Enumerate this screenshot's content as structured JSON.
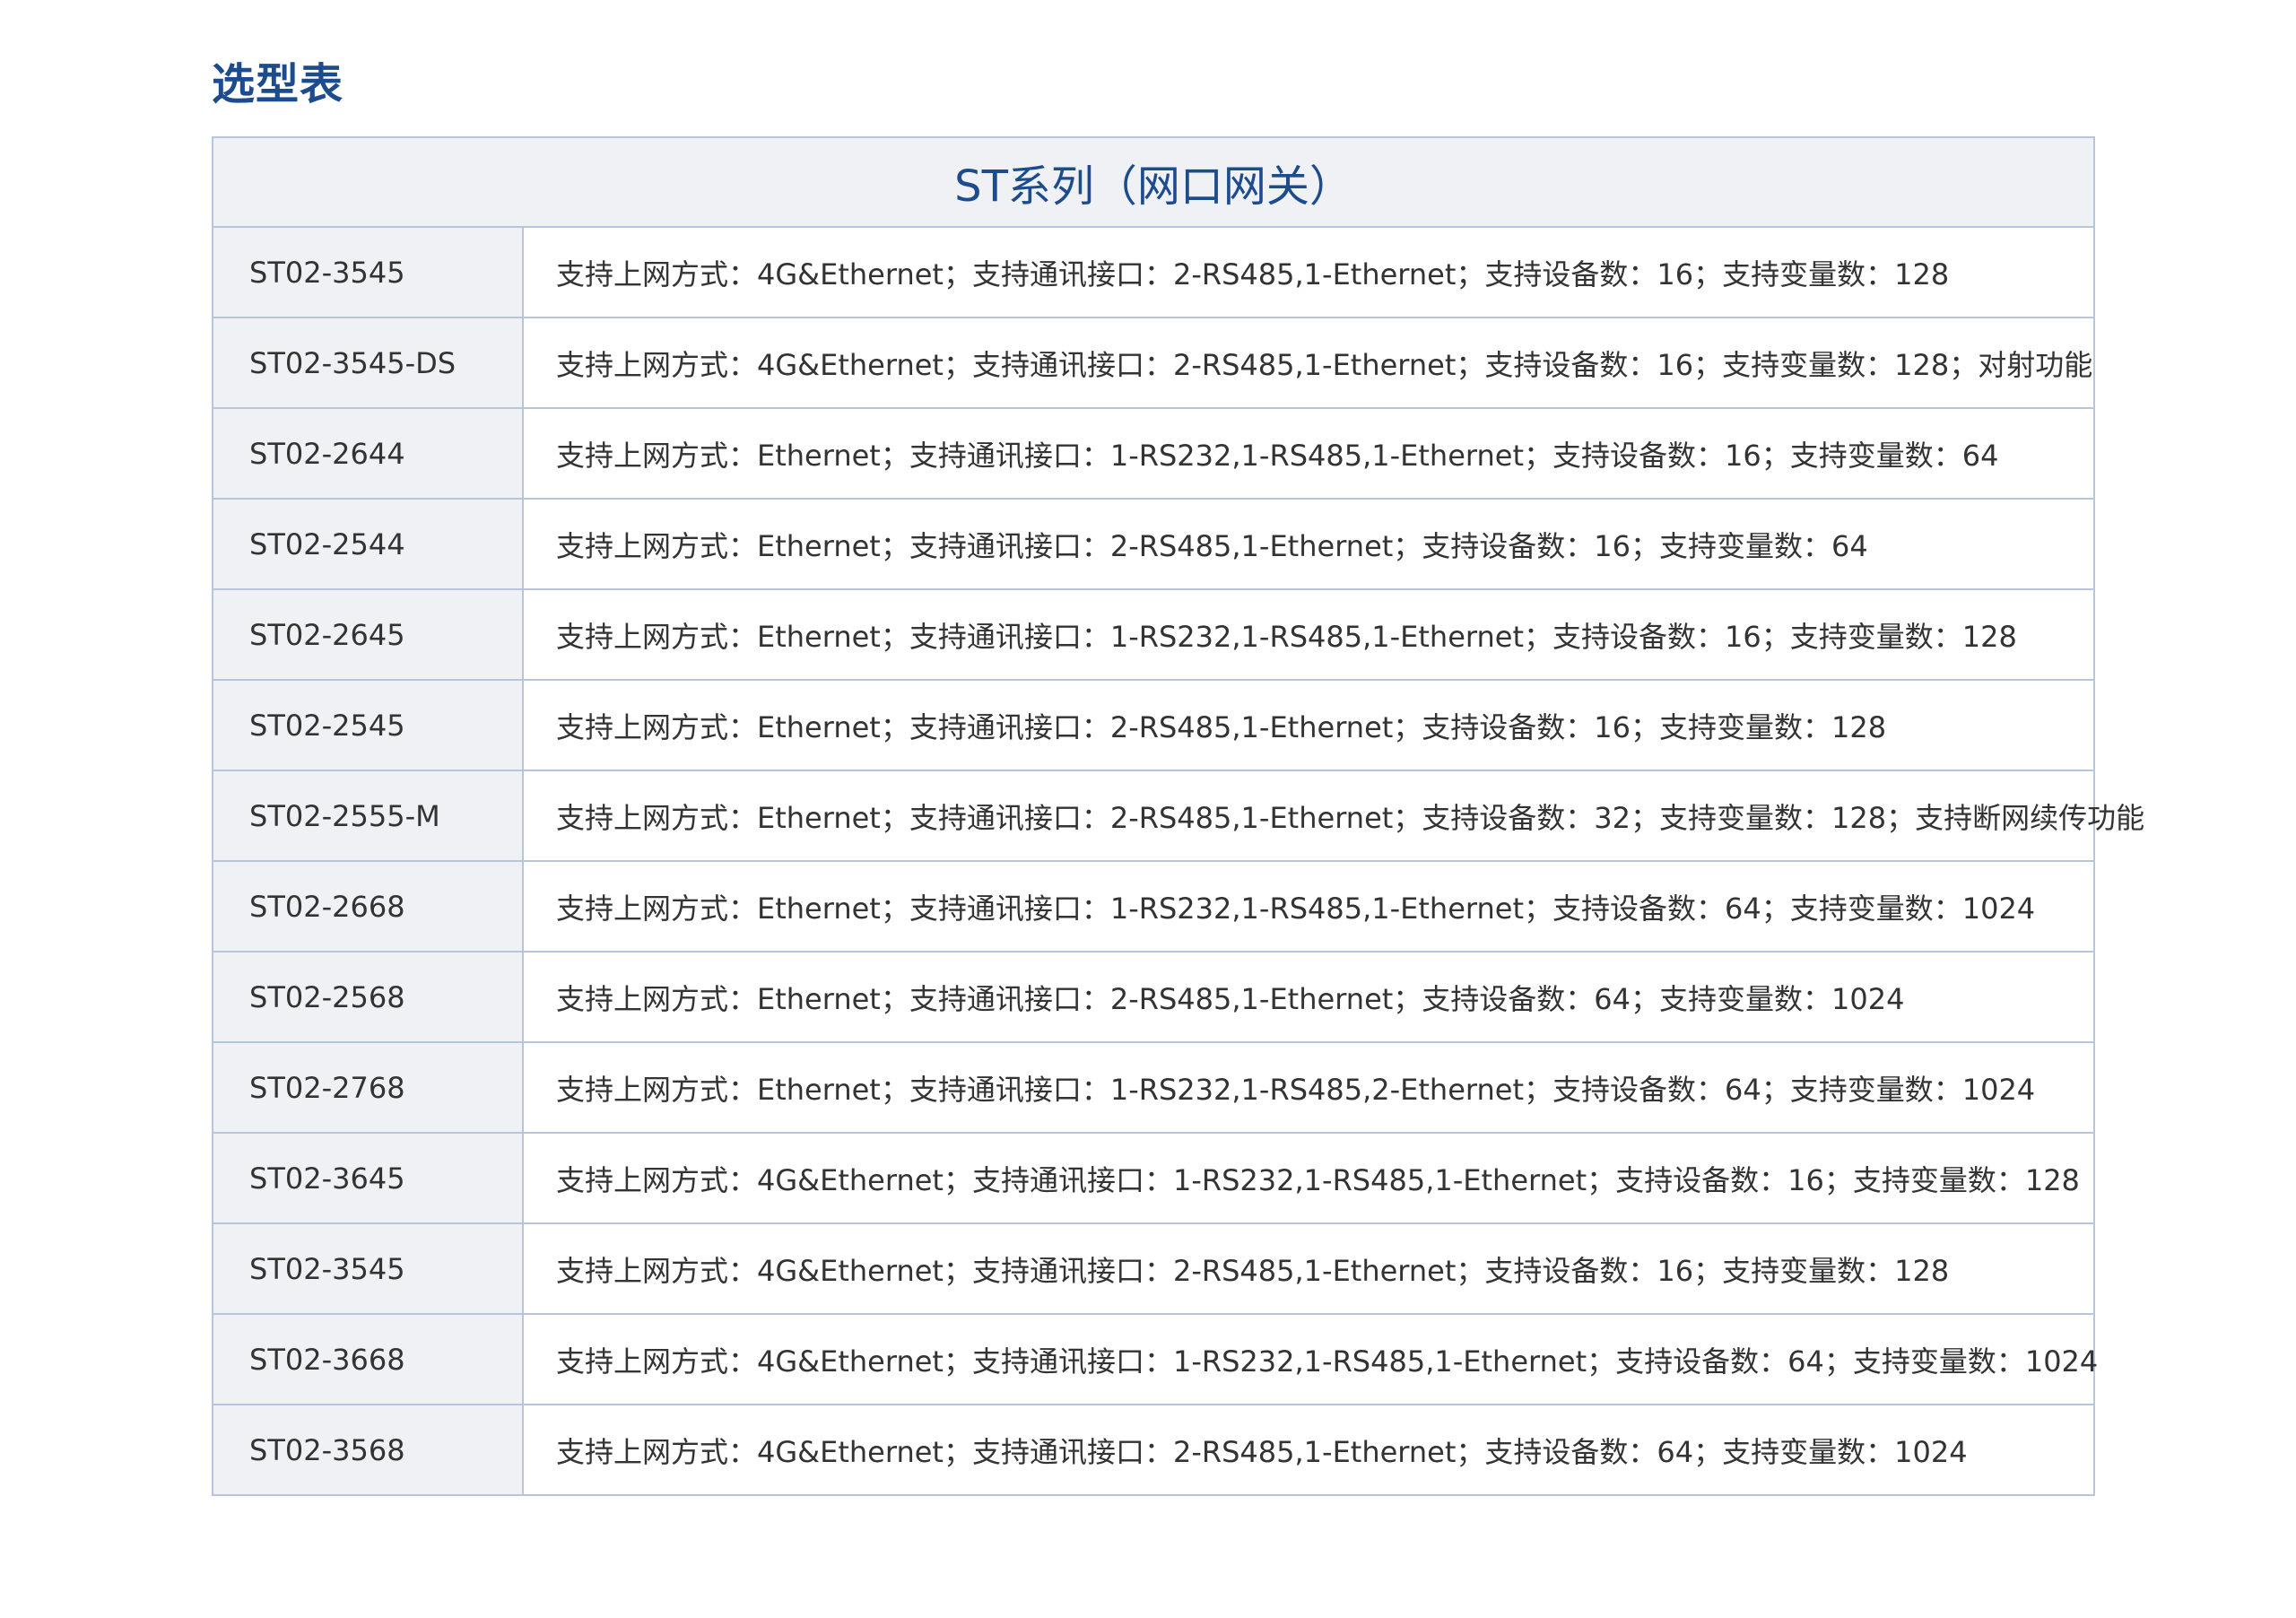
{
  "page": {
    "title": "选型表"
  },
  "table": {
    "header": "ST系列（网口网关）",
    "rows": [
      {
        "model": "ST02-3545",
        "desc": "支持上网方式：4G&Ethernet；支持通讯接口：2-RS485,1-Ethernet；支持设备数：16；支持变量数：128"
      },
      {
        "model": "ST02-3545-DS",
        "desc": "支持上网方式：4G&Ethernet；支持通讯接口：2-RS485,1-Ethernet；支持设备数：16；支持变量数：128；对射功能"
      },
      {
        "model": "ST02-2644",
        "desc": "支持上网方式：Ethernet；支持通讯接口：1-RS232,1-RS485,1-Ethernet；支持设备数：16；支持变量数：64"
      },
      {
        "model": "ST02-2544",
        "desc": "支持上网方式：Ethernet；支持通讯接口：2-RS485,1-Ethernet；支持设备数：16；支持变量数：64"
      },
      {
        "model": "ST02-2645",
        "desc": "支持上网方式：Ethernet；支持通讯接口：1-RS232,1-RS485,1-Ethernet；支持设备数：16；支持变量数：128"
      },
      {
        "model": "ST02-2545",
        "desc": "支持上网方式：Ethernet；支持通讯接口：2-RS485,1-Ethernet；支持设备数：16；支持变量数：128"
      },
      {
        "model": "ST02-2555-M",
        "desc": "支持上网方式：Ethernet；支持通讯接口：2-RS485,1-Ethernet；支持设备数：32；支持变量数：128；支持断网续传功能"
      },
      {
        "model": "ST02-2668",
        "desc": "支持上网方式：Ethernet；支持通讯接口：1-RS232,1-RS485,1-Ethernet；支持设备数：64；支持变量数：1024"
      },
      {
        "model": "ST02-2568",
        "desc": "支持上网方式：Ethernet；支持通讯接口：2-RS485,1-Ethernet；支持设备数：64；支持变量数：1024"
      },
      {
        "model": "ST02-2768",
        "desc": "支持上网方式：Ethernet；支持通讯接口：1-RS232,1-RS485,2-Ethernet；支持设备数：64；支持变量数：1024"
      },
      {
        "model": "ST02-3645",
        "desc": "支持上网方式：4G&Ethernet；支持通讯接口：1-RS232,1-RS485,1-Ethernet；支持设备数：16；支持变量数：128"
      },
      {
        "model": "ST02-3545",
        "desc": "支持上网方式：4G&Ethernet；支持通讯接口：2-RS485,1-Ethernet；支持设备数：16；支持变量数：128"
      },
      {
        "model": "ST02-3668",
        "desc": "支持上网方式：4G&Ethernet；支持通讯接口：1-RS232,1-RS485,1-Ethernet；支持设备数：64；支持变量数：1024"
      },
      {
        "model": "ST02-3568",
        "desc": "支持上网方式：4G&Ethernet；支持通讯接口：2-RS485,1-Ethernet；支持设备数：64；支持变量数：1024"
      }
    ]
  }
}
